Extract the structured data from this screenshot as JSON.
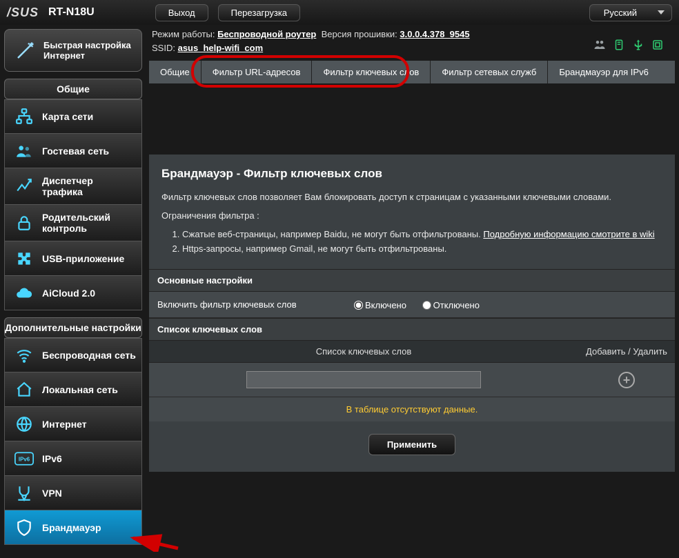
{
  "top": {
    "brand": "/SUS",
    "model": "RT-N18U",
    "logout": "Выход",
    "reboot": "Перезагрузка",
    "language": "Русский"
  },
  "info": {
    "mode_label": "Режим работы:",
    "mode_value": "Беспроводной роутер",
    "fw_label": "Версия прошивки:",
    "fw_value": "3.0.0.4.378_9545",
    "ssid_label": "SSID:",
    "ssid_value": "asus_help-wifi_com"
  },
  "tabs": {
    "general": "Общие",
    "url": "Фильтр URL-адресов",
    "keyword": "Фильтр ключевых слов",
    "netserv": "Фильтр сетевых служб",
    "ipv6fw": "Брандмауэр для IPv6"
  },
  "sidebar": {
    "quick_setup": "Быстрая настройка Интернет",
    "hdr_general": "Общие",
    "hdr_advanced": "Дополнительные настройки",
    "items_general": [
      {
        "label": "Карта сети",
        "icon": "network-map"
      },
      {
        "label": "Гостевая сеть",
        "icon": "guest"
      },
      {
        "label": "Диспетчер трафика",
        "icon": "traffic"
      },
      {
        "label": "Родительский контроль",
        "icon": "lock"
      },
      {
        "label": "USB-приложение",
        "icon": "puzzle"
      },
      {
        "label": "AiCloud 2.0",
        "icon": "cloud"
      }
    ],
    "items_advanced": [
      {
        "label": "Беспроводная сеть",
        "icon": "wifi"
      },
      {
        "label": "Локальная сеть",
        "icon": "home"
      },
      {
        "label": "Интернет",
        "icon": "globe"
      },
      {
        "label": "IPv6",
        "icon": "ipv6"
      },
      {
        "label": "VPN",
        "icon": "vpn"
      },
      {
        "label": "Брандмауэр",
        "icon": "shield",
        "active": true
      }
    ]
  },
  "main": {
    "title": "Брандмауэр - Фильтр ключевых слов",
    "desc": "Фильтр ключевых слов позволяет Вам блокировать доступ к страницам с указанными ключевыми словами.",
    "restrict_label": "Ограничения фильтра :",
    "li1_a": "Сжатые веб-страницы, например Baidu, не могут быть отфильтрованы. ",
    "li1_link": "Подробную информацию смотрите в wiki",
    "li2": "Https-запросы, например Gmail, не могут быть отфильтрованы.",
    "basic_hdr": "Основные настройки",
    "enable_label": "Включить фильтр ключевых слов",
    "radio_on": "Включено",
    "radio_off": "Отключено",
    "list_hdr": "Список ключевых слов",
    "col_kw": "Список ключевых слов",
    "col_act": "Добавить / Удалить",
    "nodata": "В таблице отсутствуют данные.",
    "apply": "Применить"
  }
}
